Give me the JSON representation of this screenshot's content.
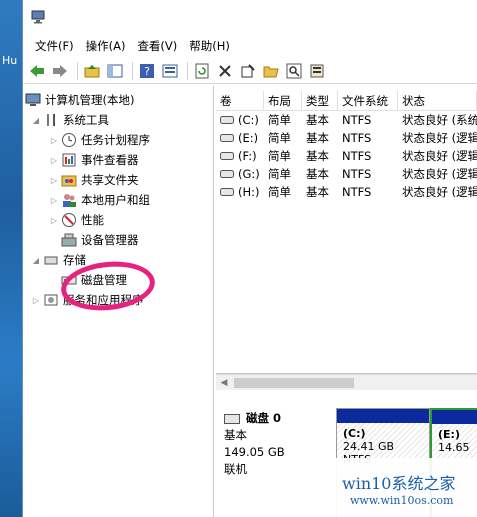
{
  "desktop": {
    "label": "Hu"
  },
  "window": {
    "menu": [
      "文件(F)",
      "操作(A)",
      "查看(V)",
      "帮助(H)"
    ],
    "toolbar_icons": [
      "back-icon",
      "forward-icon",
      "up-folder-icon",
      "show-hide-tree-icon",
      "help-icon",
      "view-icon",
      "refresh-icon",
      "delete-icon",
      "properties-icon",
      "open-icon",
      "search-icon",
      "disk-icon"
    ]
  },
  "tree": {
    "root": "计算机管理(本地)",
    "system_tools": "系统工具",
    "task_scheduler": "任务计划程序",
    "event_viewer": "事件查看器",
    "shared_folders": "共享文件夹",
    "local_users": "本地用户和组",
    "performance": "性能",
    "device_manager": "设备管理器",
    "storage": "存储",
    "disk_management": "磁盘管理",
    "services_apps": "服务和应用程序"
  },
  "volumes": {
    "headers": [
      "卷",
      "布局",
      "类型",
      "文件系统",
      "状态"
    ],
    "rows": [
      {
        "vol": "(C:)",
        "layout": "简单",
        "type": "基本",
        "fs": "NTFS",
        "status": "状态良好 (系统"
      },
      {
        "vol": "(E:)",
        "layout": "简单",
        "type": "基本",
        "fs": "NTFS",
        "status": "状态良好 (逻辑"
      },
      {
        "vol": "(F:)",
        "layout": "简单",
        "type": "基本",
        "fs": "NTFS",
        "status": "状态良好 (逻辑"
      },
      {
        "vol": "(G:)",
        "layout": "简单",
        "type": "基本",
        "fs": "NTFS",
        "status": "状态良好 (逻辑"
      },
      {
        "vol": "(H:)",
        "layout": "简单",
        "type": "基本",
        "fs": "NTFS",
        "status": "状态良好 (逻辑"
      }
    ]
  },
  "disk": {
    "name": "磁盘 0",
    "type": "基本",
    "size": "149.05 GB",
    "status": "联机",
    "partitions": [
      {
        "label": "(C:)",
        "detail": "24.41 GB NTFS"
      },
      {
        "label": "(E:)",
        "detail": "14.65"
      }
    ]
  },
  "watermark": {
    "line1": "win10系统之家",
    "line2": "www.win10os.com"
  },
  "colors": {
    "accent": "#0a2a9e",
    "highlight": "#e6217f",
    "watermark": "#1a5fa8"
  }
}
